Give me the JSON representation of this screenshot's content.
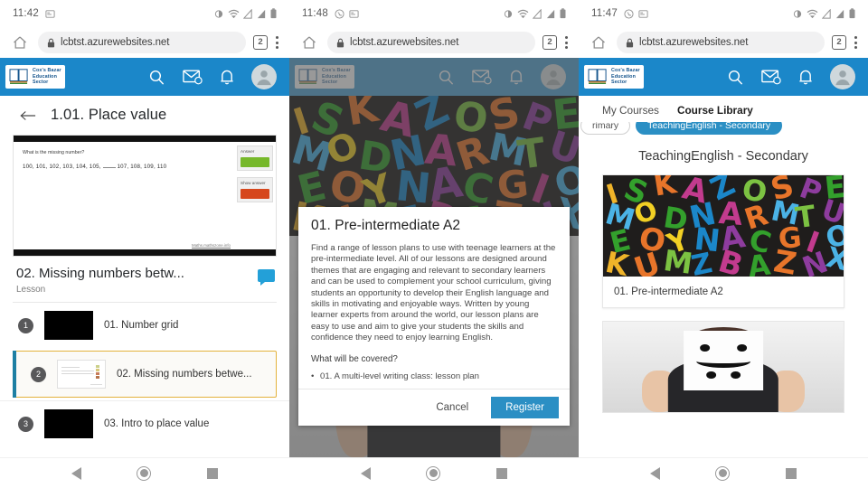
{
  "brand": {
    "line1": "Cox's Bazar",
    "line2": "Education",
    "line3": "Sector",
    "accent": "#1b87c9"
  },
  "phones": [
    {
      "status": {
        "time": "11:42"
      },
      "browser": {
        "url": "lcbtst.azurewebsites.net",
        "tabs": "2"
      },
      "page": {
        "title": "1.01. Place value",
        "viewer": {
          "question": "What is the missing number?",
          "sequence_before": "100, 101, 102, 103, 104, 105,",
          "sequence_after": "107, 108, 109, 110",
          "answer_label": "Answer",
          "show_label": "Show answer",
          "credit": "Maths.mathszone.info"
        },
        "lesson": {
          "title": "02. Missing numbers betw...",
          "subtitle": "Lesson"
        },
        "toc": [
          {
            "num": "1",
            "label": "01. Number grid",
            "active": false,
            "thumb": "video"
          },
          {
            "num": "2",
            "label": "02. Missing numbers betwe...",
            "active": true,
            "thumb": "doc"
          },
          {
            "num": "3",
            "label": "03. Intro to place value",
            "active": false,
            "thumb": "video"
          }
        ]
      }
    },
    {
      "status": {
        "time": "11:48"
      },
      "browser": {
        "url": "lcbtst.azurewebsites.net",
        "tabs": "2"
      },
      "modal": {
        "title": "01. Pre-intermediate A2",
        "paragraph": "Find a range of lesson plans to use with teenage learners at the pre-intermediate level. All of our lessons are designed around themes that are engaging and relevant to secondary learners and can be used to complement your school curriculum, giving students an opportunity to develop their English language and skills in motivating and enjoyable ways. Written by young learner experts from around the world, our lesson plans are easy to use and aim to give your students the skills and confidence they need to enjoy learning English.",
        "heading": "What will be covered?",
        "items": [
          "01. A multi-level writing class: lesson plan"
        ],
        "cancel_label": "Cancel",
        "register_label": "Register",
        "register_color": "#2b8fc4"
      }
    },
    {
      "status": {
        "time": "11:47"
      },
      "browser": {
        "url": "lcbtst.azurewebsites.net",
        "tabs": "2"
      },
      "library": {
        "tabs": [
          {
            "label": "My Courses",
            "selected": false
          },
          {
            "label": "Course Library",
            "selected": true
          }
        ],
        "chips": [
          {
            "label": "rimary",
            "selected": false
          },
          {
            "label": "TeachingEnglish - Secondary",
            "selected": true
          }
        ],
        "section_title": "TeachingEnglish - Secondary",
        "cards": [
          {
            "caption": "01. Pre-intermediate A2",
            "image": "letters"
          },
          {
            "caption": "",
            "image": "smiley"
          }
        ]
      }
    }
  ],
  "navbar": {
    "back": "back-button",
    "home": "home-button",
    "recent": "recent-apps-button"
  }
}
